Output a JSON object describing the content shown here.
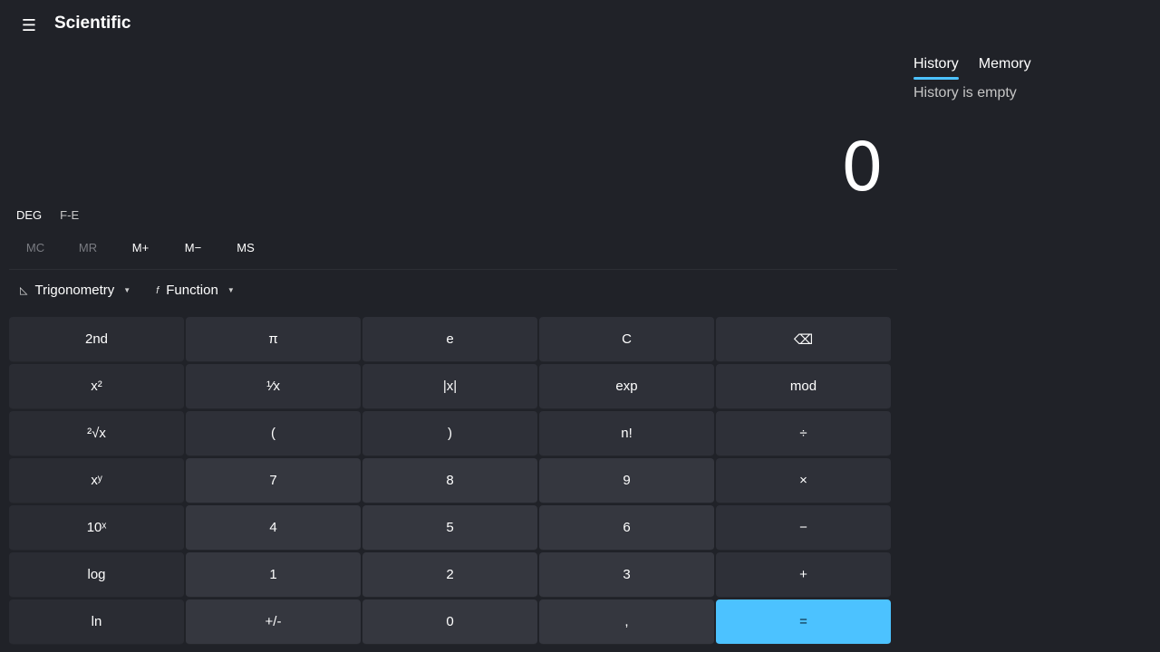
{
  "header": {
    "menu_icon": "hamburger-icon",
    "title": "Scientific"
  },
  "display": {
    "value": "0"
  },
  "mode": {
    "angle": "DEG",
    "fe": "F-E"
  },
  "memory": {
    "mc": "MC",
    "mr": "MR",
    "mplus": "M+",
    "mminus": "M−",
    "ms": "MS"
  },
  "dropdowns": {
    "trig": {
      "icon": "trig-triangle-icon",
      "label": "Trigonometry"
    },
    "func": {
      "icon": "function-icon",
      "label": "Function"
    }
  },
  "keys": [
    [
      "2nd",
      "π",
      "e",
      "C",
      "⌫"
    ],
    [
      "x²",
      "¹⁄x",
      "|x|",
      "exp",
      "mod"
    ],
    [
      "²√x",
      "(",
      ")",
      "n!",
      "÷"
    ],
    [
      "xʸ",
      "7",
      "8",
      "9",
      "×"
    ],
    [
      "10ˣ",
      "4",
      "5",
      "6",
      "−"
    ],
    [
      "log",
      "1",
      "2",
      "3",
      "+"
    ],
    [
      "ln",
      "+/-",
      "0",
      ",",
      "="
    ]
  ],
  "side": {
    "tabs": [
      "History",
      "Memory"
    ],
    "active_tab": "History",
    "empty_message": "History is empty"
  },
  "colors": {
    "accent": "#4cc2ff",
    "background": "#202228",
    "key": "#35373f"
  }
}
